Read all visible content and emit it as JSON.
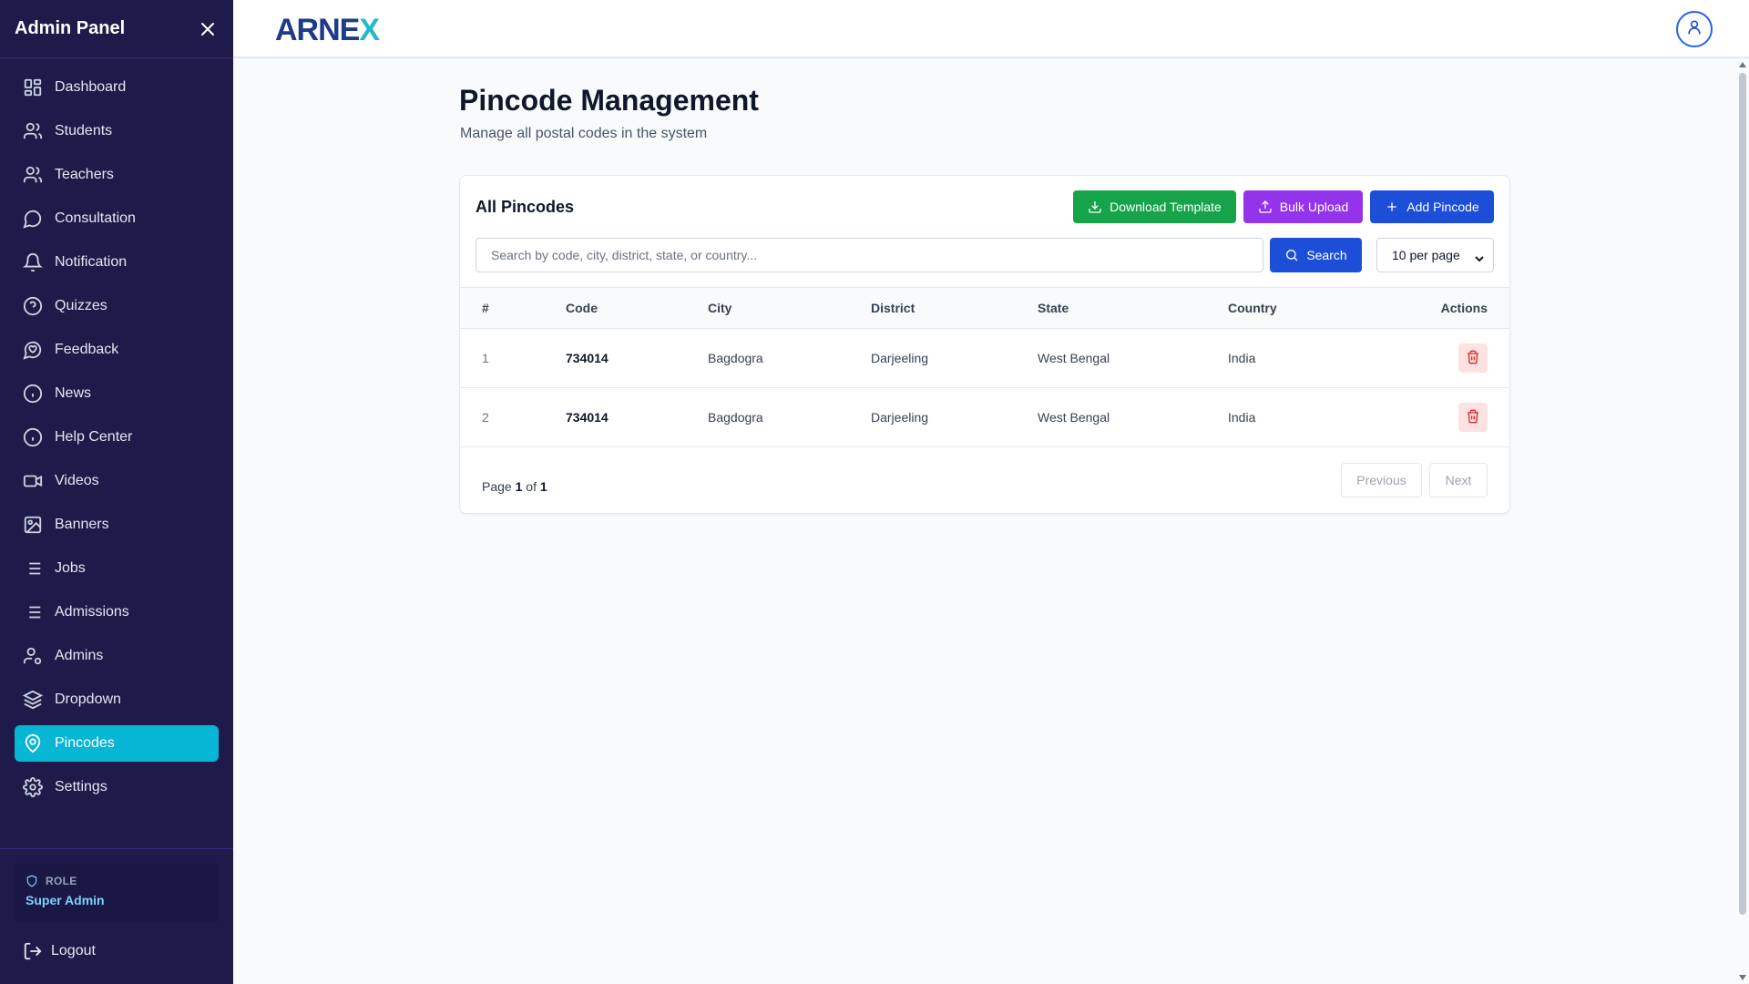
{
  "sidebar": {
    "title": "Admin Panel",
    "items": [
      {
        "label": "Dashboard",
        "icon": "dashboard-icon"
      },
      {
        "label": "Students",
        "icon": "users-icon"
      },
      {
        "label": "Teachers",
        "icon": "users-icon"
      },
      {
        "label": "Consultation",
        "icon": "chat-icon"
      },
      {
        "label": "Notification",
        "icon": "bell-icon"
      },
      {
        "label": "Quizzes",
        "icon": "help-circle-icon"
      },
      {
        "label": "Feedback",
        "icon": "heart-chat-icon"
      },
      {
        "label": "News",
        "icon": "info-icon"
      },
      {
        "label": "Help Center",
        "icon": "info-icon"
      },
      {
        "label": "Videos",
        "icon": "video-icon"
      },
      {
        "label": "Banners",
        "icon": "image-icon"
      },
      {
        "label": "Jobs",
        "icon": "list-icon"
      },
      {
        "label": "Admissions",
        "icon": "list-icon"
      },
      {
        "label": "Admins",
        "icon": "user-cog-icon"
      },
      {
        "label": "Dropdown",
        "icon": "layers-icon"
      },
      {
        "label": "Pincodes",
        "icon": "map-pin-icon",
        "active": true
      },
      {
        "label": "Settings",
        "icon": "gear-icon"
      }
    ],
    "role_label": "ROLE",
    "role_value": "Super Admin",
    "logout_label": "Logout",
    "active_color": "#06b6d4",
    "bg_color": "#1e1b4b"
  },
  "header": {
    "logo_part1": "AR",
    "logo_part2": "NE",
    "logo_part3": "X"
  },
  "page": {
    "title": "Pincode Management",
    "subtitle": "Manage all postal codes in the system"
  },
  "card": {
    "title": "All Pincodes",
    "download_label": "Download Template",
    "bulk_label": "Bulk Upload",
    "add_label": "Add Pincode",
    "search_placeholder": "Search by code, city, district, state, or country...",
    "search_value": "",
    "search_button": "Search",
    "per_page": "10 per page"
  },
  "table": {
    "headers": {
      "num": "#",
      "code": "Code",
      "city": "City",
      "district": "District",
      "state": "State",
      "country": "Country",
      "actions": "Actions"
    },
    "rows": [
      {
        "num": "1",
        "code": "734014",
        "city": "Bagdogra",
        "district": "Darjeeling",
        "state": "West Bengal",
        "country": "India"
      },
      {
        "num": "2",
        "code": "734014",
        "city": "Bagdogra",
        "district": "Darjeeling",
        "state": "West Bengal",
        "country": "India"
      }
    ]
  },
  "pagination": {
    "page_word": "Page",
    "current": "1",
    "of_word": "of",
    "total": "1",
    "previous": "Previous",
    "next": "Next"
  },
  "colors": {
    "green": "#16a34a",
    "purple": "#9333ea",
    "blue": "#1d4ed8",
    "danger": "#dc2626"
  }
}
